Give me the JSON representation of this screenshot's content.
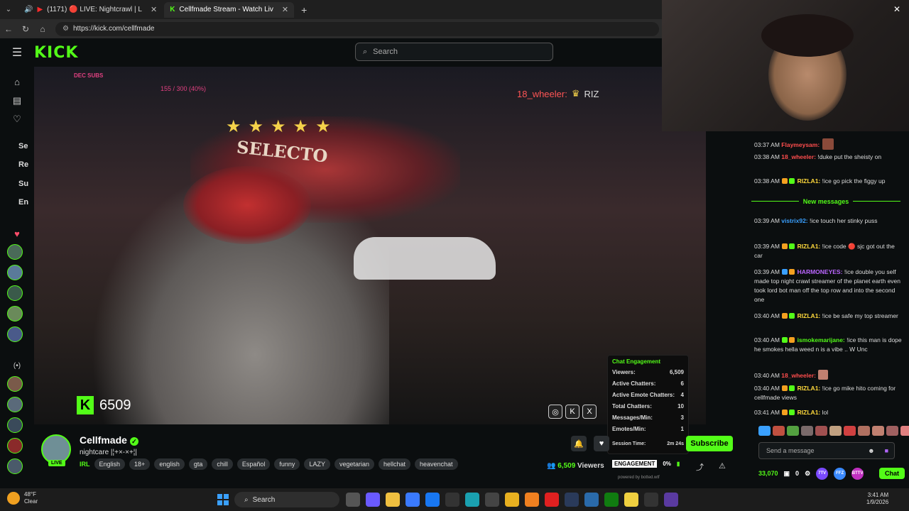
{
  "browser": {
    "tabs": [
      {
        "label": "(1171) 🔴 LIVE: Nightcrawl | L"
      },
      {
        "label": "Cellfmade Stream - Watch Liv"
      }
    ],
    "new_tab": "+",
    "url": "https://kick.com/cellfmade"
  },
  "header": {
    "logo": "KICK",
    "search_placeholder": "Search"
  },
  "sidebar": {
    "sections": [
      "Se",
      "Re",
      "Su",
      "En"
    ]
  },
  "video": {
    "overlay_subs": "DEC SUBS",
    "overlay_goal": "155 / 300 (40%)",
    "overlay_chat_user": "18_wheeler:",
    "overlay_chat_text": "RIZ",
    "mall_sign": "SELECTO",
    "viewer_count": "6509",
    "k_logo": "K"
  },
  "engagement": {
    "title": "Chat Engagement",
    "rows": [
      {
        "label": "Viewers:",
        "value": "6,509"
      },
      {
        "label": "Active Chatters:",
        "value": "6"
      },
      {
        "label": "Active Emote Chatters:",
        "value": "4"
      },
      {
        "label": "Total Chatters:",
        "value": "10"
      },
      {
        "label": "Messages/Min:",
        "value": "3"
      },
      {
        "label": "Emotes/Min:",
        "value": "1"
      },
      {
        "label": "Session Time:",
        "value": "2m 24s"
      }
    ],
    "bar_label": "ENGAGEMENT",
    "bar_value": "0%",
    "powered_by": "powered by botted.wtf"
  },
  "streamer": {
    "name": "Cellfmade",
    "live": "LIVE",
    "title": "nightcare |¦+×-×+¦|",
    "category": "IRL",
    "tags": [
      "English",
      "18+",
      "english",
      "gta",
      "chill",
      "Español",
      "funny",
      "LAZY",
      "vegetarian",
      "hellchat",
      "heavenchat"
    ],
    "viewers_count": "6,509",
    "viewers_label": "Viewers",
    "subscribe": "Subscribe"
  },
  "chat": {
    "messages": [
      {
        "time": "03:37 AM",
        "user": "Flaymeysam:",
        "text": "",
        "color": "#ff4d4d"
      },
      {
        "time": "03:38 AM",
        "user": "18_wheeler:",
        "text": "!duke put the sheisty on",
        "color": "#ff4d4d"
      },
      {
        "time": "03:38 AM",
        "user": "RIZLA1:",
        "text": "!ice go pick the figgy up",
        "color": "#ffd93b"
      },
      {
        "time": "03:39 AM",
        "user": "vistrix92:",
        "text": "!ice touch her stinky puss",
        "color": "#3aa0ff"
      },
      {
        "time": "03:39 AM",
        "user": "RIZLA1:",
        "text": "!ice code 🔴 sjc got out the car",
        "color": "#ffd93b"
      },
      {
        "time": "03:39 AM",
        "user": "HARMONEYES:",
        "text": "!ice double you self made top night crawl streamer of the planet earth even took lord bot man off the top row and into the second one",
        "color": "#bb66ff"
      },
      {
        "time": "03:40 AM",
        "user": "RIZLA1:",
        "text": "!ice be safe my top streamer",
        "color": "#ffd93b"
      },
      {
        "time": "03:40 AM",
        "user": "ismokemarijane:",
        "text": "!ice this man is dope he smokes hella weed n is a vibe .. W Unc",
        "color": "#53fc18"
      },
      {
        "time": "03:40 AM",
        "user": "18_wheeler:",
        "text": "",
        "color": "#ff4d4d"
      },
      {
        "time": "03:40 AM",
        "user": "RIZLA1:",
        "text": "!ice go mike hito coming for cellfmade views",
        "color": "#ffd93b"
      },
      {
        "time": "03:41 AM",
        "user": "RIZLA1:",
        "text": "lol",
        "color": "#ffd93b"
      }
    ],
    "new_messages": "New messages",
    "send_placeholder": "Send a message",
    "points": "33,070",
    "gift_count": "0",
    "chat_button": "Chat",
    "pills": [
      "7TV",
      "FFZ",
      "BTTV"
    ]
  },
  "taskbar": {
    "temp": "48°F",
    "condition": "Clear",
    "search": "Search",
    "time": "3:41 AM",
    "date": "1/9/2026"
  },
  "colors": {
    "accent": "#53fc18",
    "bg": "#0b0e0f"
  }
}
